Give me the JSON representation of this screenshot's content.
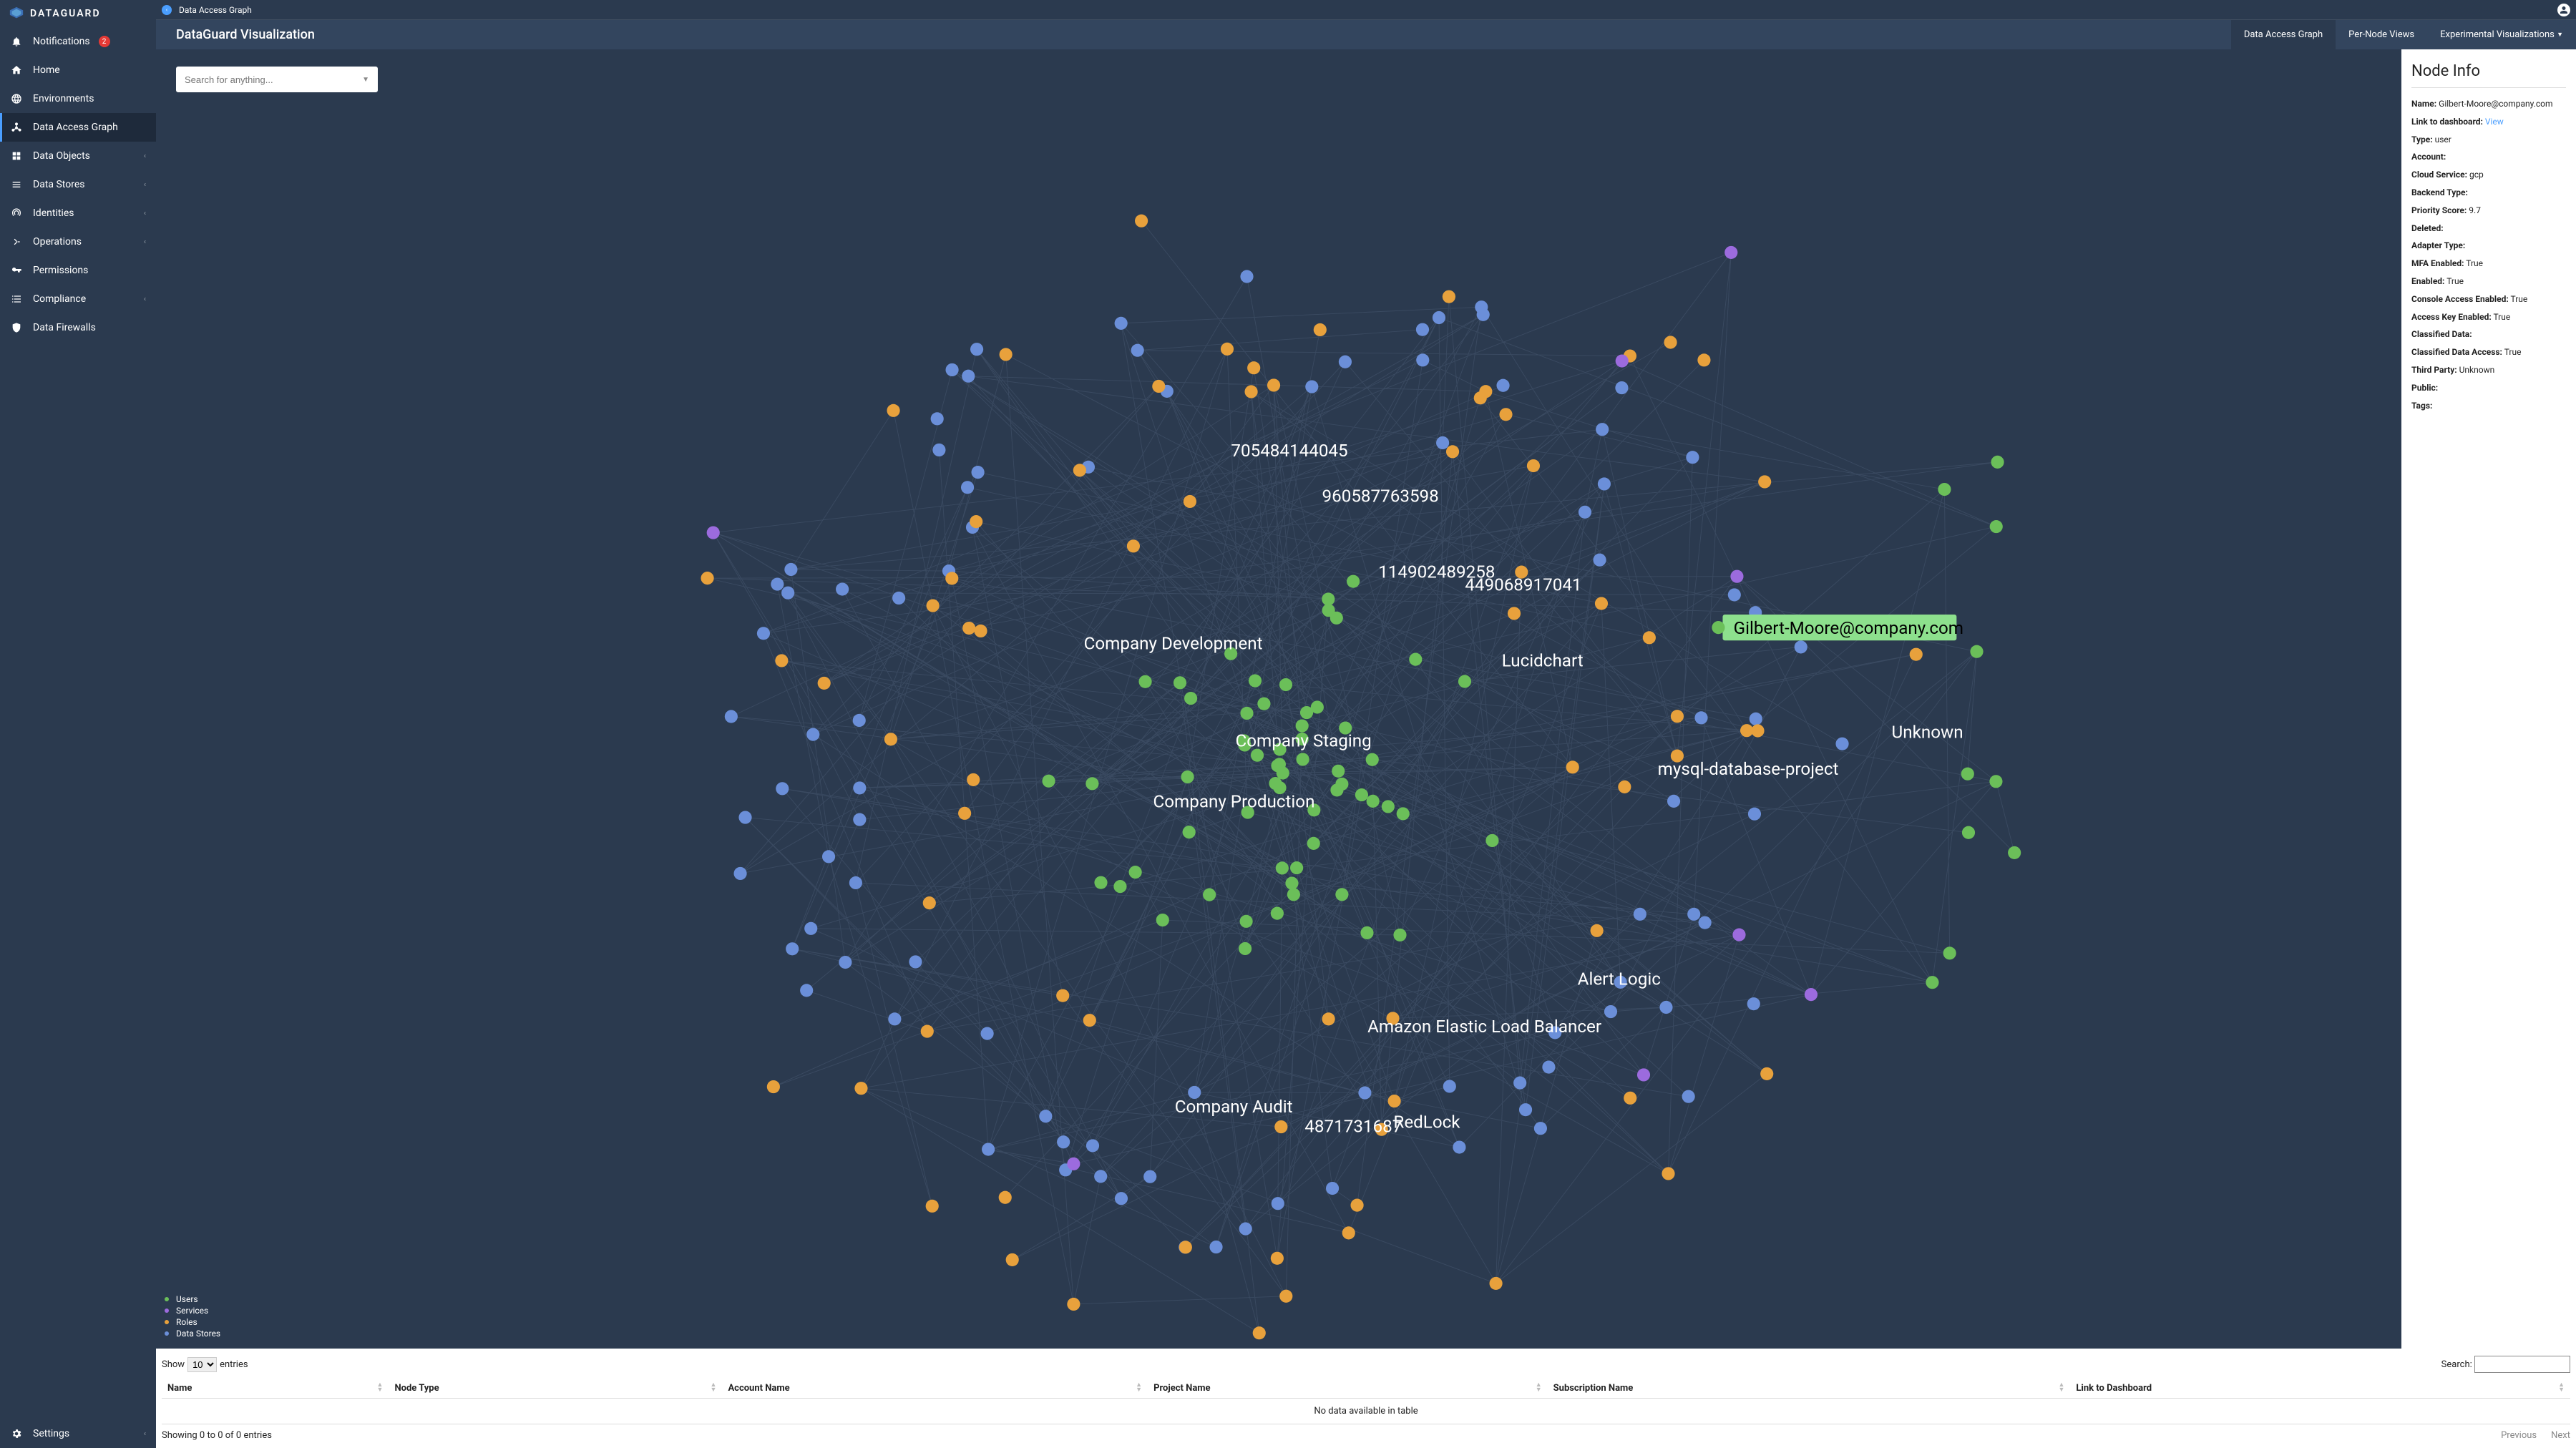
{
  "brand": {
    "name": "DATAGUARD"
  },
  "sidebar": {
    "items": [
      {
        "label": "Notifications",
        "badge": "2"
      },
      {
        "label": "Home"
      },
      {
        "label": "Environments"
      },
      {
        "label": "Data Access Graph"
      },
      {
        "label": "Data Objects"
      },
      {
        "label": "Data Stores"
      },
      {
        "label": "Identities"
      },
      {
        "label": "Operations"
      },
      {
        "label": "Permissions"
      },
      {
        "label": "Compliance"
      },
      {
        "label": "Data Firewalls"
      }
    ],
    "settings_label": "Settings"
  },
  "breadcrumb": {
    "current": "Data Access Graph"
  },
  "header": {
    "title": "DataGuard Visualization"
  },
  "tabs": [
    {
      "label": "Data Access Graph"
    },
    {
      "label": "Per-Node Views"
    },
    {
      "label": "Experimental Visualizations"
    }
  ],
  "search": {
    "placeholder": "Search for anything..."
  },
  "graph_labels": {
    "l0": "705484144045",
    "l1": "960587763598",
    "l2": "114902489258",
    "l3": "449068917041",
    "l4": "Company Development",
    "l5": "Lucidchart",
    "l6": "Company Staging",
    "l7": "mysql-database-project",
    "l8": "Company Production",
    "l9": "Unknown",
    "l10": "Alert Logic",
    "l11": "Amazon Elastic Load Balancer",
    "l12": "Company Audit",
    "l13": "4871731687",
    "l14": "RedLock",
    "highlight": "Gilbert-Moore@company.com"
  },
  "legend": {
    "users": "Users",
    "services": "Services",
    "roles": "Roles",
    "datastores": "Data Stores"
  },
  "node_info": {
    "heading": "Node Info",
    "name_k": "Name:",
    "name_v": "Gilbert-Moore@company.com",
    "link_k": "Link to dashboard:",
    "link_v": "View",
    "type_k": "Type:",
    "type_v": "user",
    "account_k": "Account:",
    "account_v": "",
    "cloud_k": "Cloud Service:",
    "cloud_v": "gcp",
    "backend_k": "Backend Type:",
    "backend_v": "",
    "priority_k": "Priority Score:",
    "priority_v": "9.7",
    "deleted_k": "Deleted:",
    "deleted_v": "",
    "adapter_k": "Adapter Type:",
    "adapter_v": "",
    "mfa_k": "MFA Enabled:",
    "mfa_v": "True",
    "enabled_k": "Enabled:",
    "enabled_v": "True",
    "console_k": "Console Access Enabled:",
    "console_v": "True",
    "access_k": "Access Key Enabled:",
    "access_v": "True",
    "classified_k": "Classified Data:",
    "classified_v": "",
    "classified_access_k": "Classified Data Access:",
    "classified_access_v": "True",
    "third_k": "Third Party:",
    "third_v": "Unknown",
    "public_k": "Public:",
    "public_v": "",
    "tags_k": "Tags:",
    "tags_v": ""
  },
  "table": {
    "show_prefix": "Show",
    "show_value": "10",
    "show_suffix": "entries",
    "search_label": "Search:",
    "columns": {
      "c0": "Name",
      "c1": "Node Type",
      "c2": "Account Name",
      "c3": "Project Name",
      "c4": "Subscription Name",
      "c5": "Link to Dashboard"
    },
    "nodata": "No data available in table",
    "footer_info": "Showing 0 to 0 of 0 entries",
    "prev": "Previous",
    "next": "Next"
  },
  "colors": {
    "users": "#6bbf59",
    "services": "#9c6bde",
    "roles": "#e8a13c",
    "datastores": "#6b8fd9"
  }
}
